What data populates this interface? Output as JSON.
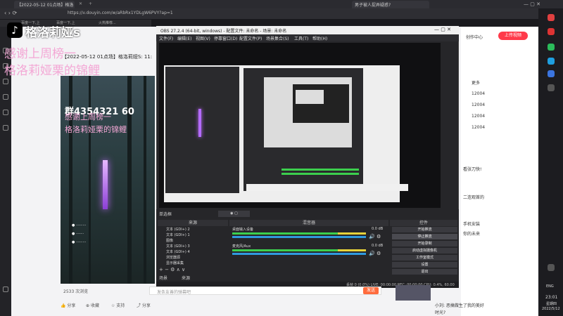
{
  "browser": {
    "tab_title": "【2022-05-12 01点场】格洛",
    "tab_right_title": "男子被人捉弄疑惑?",
    "url": "https://v.douyin.com/w/aRbRx1YDLgW6PVY?ap=1",
    "bookmarks": [
      "百度一下,上",
      "百度一下,上",
      "火热推荐..."
    ]
  },
  "stream": {
    "header_title": "【2022-05-12 01点场】格洛莉娅S: 11:",
    "brand": "格洛莉娅s",
    "thanks_line1": "感谢上周榜一",
    "thanks_line2": "格洛莉娅栗的锦鲤",
    "qq_group": "群4354321 60",
    "viewer_count": "2533 次浏览"
  },
  "obs": {
    "title": "OBS 27.2.4 (64-bit, windows) - 配置文件: 未命名 - 场景: 未命名",
    "menu": [
      "文件(F)",
      "编辑(E)",
      "视图(V)",
      "停靠窗口(D)",
      "配置文件(P)",
      "场景集合(S)",
      "工具(T)",
      "帮助(H)"
    ],
    "docks": {
      "scenes_label": "场景",
      "sources_label": "来源",
      "mixer_label": "混音器",
      "controls_label": "控件",
      "transitions_label": "单选框"
    },
    "scene_items": [
      "文本 (GDI+) 2",
      "文本 (GDI+) 1",
      "图像",
      "文本 (GDI+) 3",
      "文本 (GDI+) 4",
      "浏览器源",
      "显示器采集"
    ],
    "mixer_tracks": [
      {
        "name": "桌面输入设备",
        "db": "0.0 dB"
      },
      {
        "name": "麦克风/Aux",
        "db": "0.0 dB"
      }
    ],
    "controls": [
      "开始推流",
      "停止推流",
      "开始录制",
      "启动虚拟摄像机",
      "工作室模式",
      "设置",
      "退出"
    ],
    "status": "丢帧 0 (0.0%)   LIVE: 00:00:00   REC: 00:00:00   CPU: 0.4%, 60.00 fps"
  },
  "chat": {
    "placeholder": "发条友善的弹幕吧",
    "send_label": "发送"
  },
  "actions": [
    "分享",
    "收藏",
    "支持",
    "分享"
  ],
  "right": {
    "upload_label": "上传视频",
    "creator_center": "创作中心",
    "lines": [
      "更多",
      "12004",
      "12004",
      "12004",
      "12004",
      "看张刀快!",
      "二连观首的",
      "你的未来",
      "手机安装",
      "小刘: 恶搞做生了我的美好",
      "时光?"
    ],
    "clock_time": "23:01",
    "clock_day": "星期四",
    "clock_date": "2022/5/12",
    "lang": "ENG"
  },
  "colors": {
    "accent_orange": "#ff6b3d",
    "upload_red": "#ff3a4a",
    "meter_green": "#3ccf4e",
    "meter_yellow": "#e6d23a",
    "purple_glow": "#c06bff",
    "pink_text": "#f3a7d5"
  }
}
